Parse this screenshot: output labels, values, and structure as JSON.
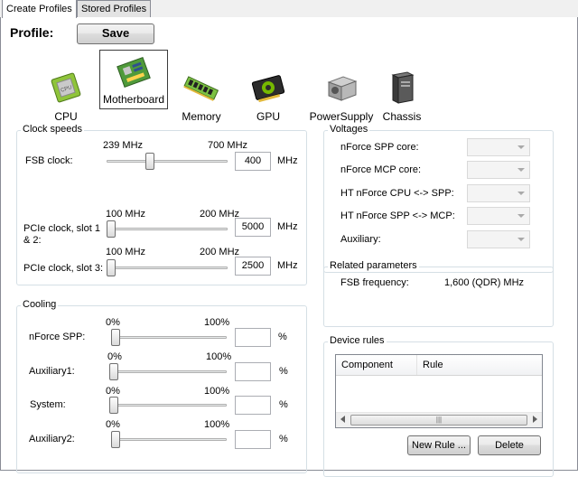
{
  "tabs": {
    "create": "Create Profiles",
    "stored": "Stored Profiles"
  },
  "profile": {
    "label": "Profile:",
    "save": "Save"
  },
  "devices": [
    {
      "label": "CPU",
      "icon": "cpu-icon"
    },
    {
      "label": "Motherboard",
      "icon": "motherboard-icon"
    },
    {
      "label": "Memory",
      "icon": "memory-icon"
    },
    {
      "label": "GPU",
      "icon": "gpu-icon"
    },
    {
      "label": "PowerSupply",
      "icon": "power-supply-icon"
    },
    {
      "label": "Chassis",
      "icon": "chassis-icon"
    }
  ],
  "clock": {
    "title": "Clock speeds",
    "fsb": {
      "label": "FSB clock:",
      "min": "239 MHz",
      "max": "700 MHz",
      "value": "400",
      "unit": "MHz"
    },
    "pcie12": {
      "label1": "PCIe clock, slot 1",
      "label2": "& 2:",
      "min": "100 MHz",
      "max": "200 MHz",
      "value": "5000",
      "unit": "MHz"
    },
    "pcie3": {
      "label": "PCIe clock, slot 3:",
      "min": "100 MHz",
      "max": "200 MHz",
      "value": "2500",
      "unit": "MHz"
    }
  },
  "cooling": {
    "title": "Cooling",
    "rows": [
      {
        "label": "nForce SPP:",
        "min": "0%",
        "max": "100%",
        "value": "",
        "unit": "%"
      },
      {
        "label": "Auxiliary1:",
        "min": "0%",
        "max": "100%",
        "value": "",
        "unit": "%"
      },
      {
        "label": "System:",
        "min": "0%",
        "max": "100%",
        "value": "",
        "unit": "%"
      },
      {
        "label": "Auxiliary2:",
        "min": "0%",
        "max": "100%",
        "value": "",
        "unit": "%"
      }
    ]
  },
  "voltages": {
    "title": "Voltages",
    "rows": [
      {
        "label": "nForce SPP core:",
        "value": ""
      },
      {
        "label": "nForce MCP core:",
        "value": ""
      },
      {
        "label": "HT nForce CPU <-> SPP:",
        "value": ""
      },
      {
        "label": "HT nForce SPP <-> MCP:",
        "value": ""
      },
      {
        "label": "Auxiliary:",
        "value": ""
      }
    ]
  },
  "related": {
    "title": "Related parameters",
    "fsb_freq_label": "FSB frequency:",
    "fsb_freq_value": "1,600 (QDR) MHz"
  },
  "device_rules": {
    "title": "Device rules",
    "columns": [
      "Component",
      "Rule"
    ],
    "rows": [],
    "new_rule": "New Rule ...",
    "delete": "Delete"
  }
}
